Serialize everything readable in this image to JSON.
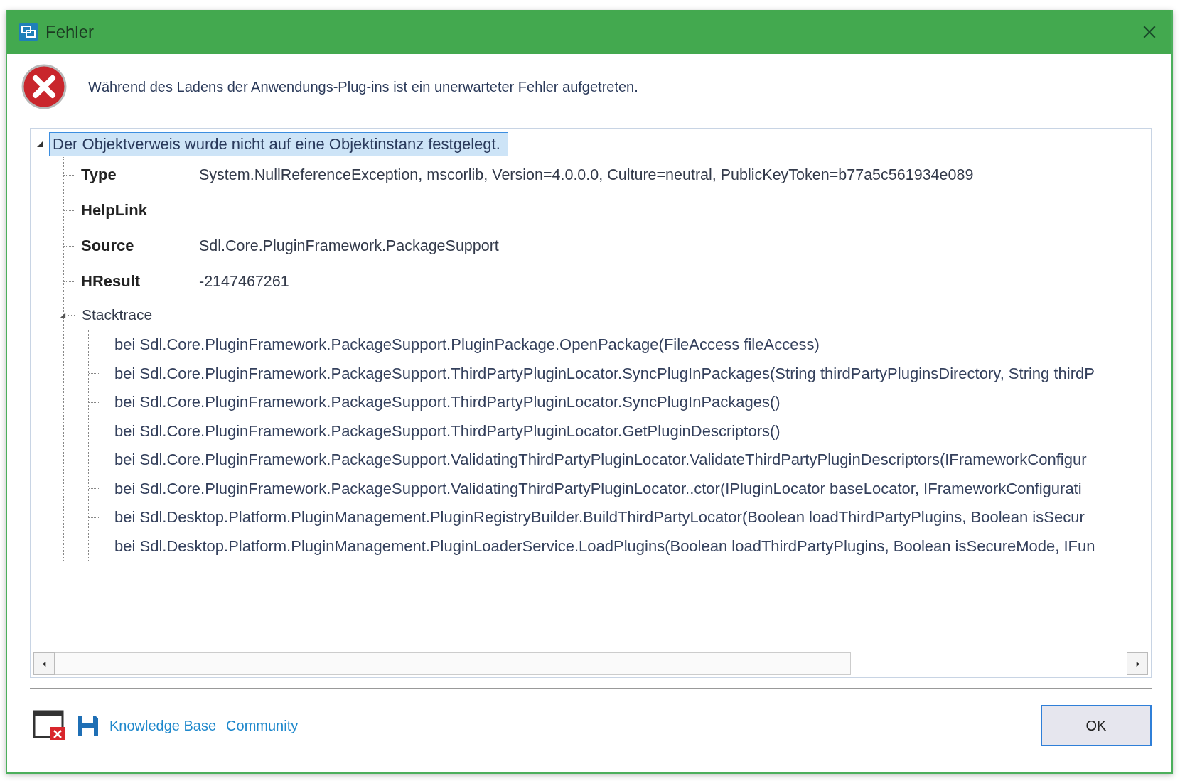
{
  "window": {
    "title": "Fehler"
  },
  "message": "Während des Ladens der Anwendungs-Plug-ins ist ein unerwarteter Fehler aufgetreten.",
  "tree": {
    "label": "Der Objektverweis wurde nicht auf eine Objektinstanz festgelegt.",
    "selected": true,
    "expanded": true,
    "properties": [
      {
        "name": "Type",
        "value": "System.NullReferenceException, mscorlib, Version=4.0.0.0, Culture=neutral, PublicKeyToken=b77a5c561934e089"
      },
      {
        "name": "HelpLink"
      },
      {
        "name": "Source",
        "value": "Sdl.Core.PluginFramework.PackageSupport"
      },
      {
        "name": "HResult",
        "value": "-2147467261"
      }
    ],
    "stacktrace": {
      "label": "Stacktrace",
      "expanded": true,
      "lines": [
        "bei Sdl.Core.PluginFramework.PackageSupport.PluginPackage.OpenPackage(FileAccess fileAccess)",
        "bei Sdl.Core.PluginFramework.PackageSupport.ThirdPartyPluginLocator.SyncPlugInPackages(String thirdPartyPluginsDirectory, String thirdP",
        "bei Sdl.Core.PluginFramework.PackageSupport.ThirdPartyPluginLocator.SyncPlugInPackages()",
        "bei Sdl.Core.PluginFramework.PackageSupport.ThirdPartyPluginLocator.GetPluginDescriptors()",
        "bei Sdl.Core.PluginFramework.PackageSupport.ValidatingThirdPartyPluginLocator.ValidateThirdPartyPluginDescriptors(IFrameworkConfigur",
        "bei Sdl.Core.PluginFramework.PackageSupport.ValidatingThirdPartyPluginLocator..ctor(IPluginLocator baseLocator, IFrameworkConfigurati",
        "bei Sdl.Desktop.Platform.PluginManagement.PluginRegistryBuilder.BuildThirdPartyLocator(Boolean loadThirdPartyPlugins, Boolean isSecur",
        "bei Sdl.Desktop.Platform.PluginManagement.PluginLoaderService.LoadPlugins(Boolean loadThirdPartyPlugins, Boolean isSecureMode, IFun"
      ]
    }
  },
  "footer": {
    "links": [
      "Knowledge Base",
      "Community"
    ],
    "button": "OK"
  }
}
